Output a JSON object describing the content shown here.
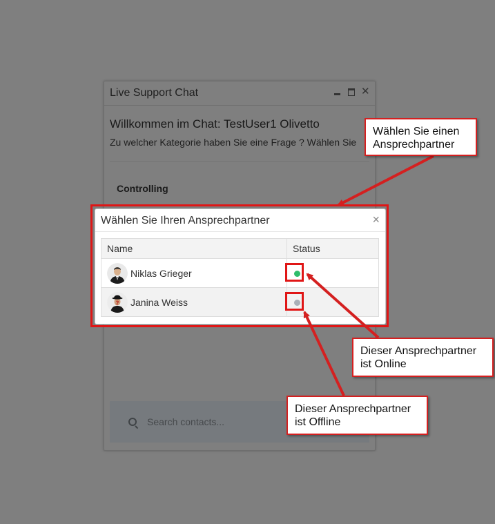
{
  "chat_window": {
    "title": "Live Support Chat",
    "welcome": "Willkommen im Chat: TestUser1 Olivetto",
    "question": "Zu welcher Kategorie haben Sie eine Frage ? Wählen Sie",
    "category": "Controlling",
    "search": {
      "placeholder": "Search contacts..."
    },
    "controls": {
      "minimize": "minimize-icon",
      "maximize": "maximize-icon",
      "close": "close-icon"
    }
  },
  "modal": {
    "title": "Wählen Sie Ihren Ansprechpartner",
    "close_label": "×",
    "columns": {
      "name": "Name",
      "status": "Status"
    },
    "contacts": [
      {
        "name": "Niklas Grieger",
        "status": "online",
        "status_color": "#2ebd6b",
        "avatar_icon": "avatar-man-suit-icon"
      },
      {
        "name": "Janina Weiss",
        "status": "offline",
        "status_color": "#aab0b8",
        "avatar_icon": "avatar-bowler-hat-icon"
      }
    ]
  },
  "annotations": {
    "choose_partner": "Wählen Sie einen Ansprechpartner",
    "online": "Dieser Ansprechpartner ist Online",
    "offline": "Dieser Ansprechpartner ist Offline",
    "highlight_color": "#e01616"
  }
}
